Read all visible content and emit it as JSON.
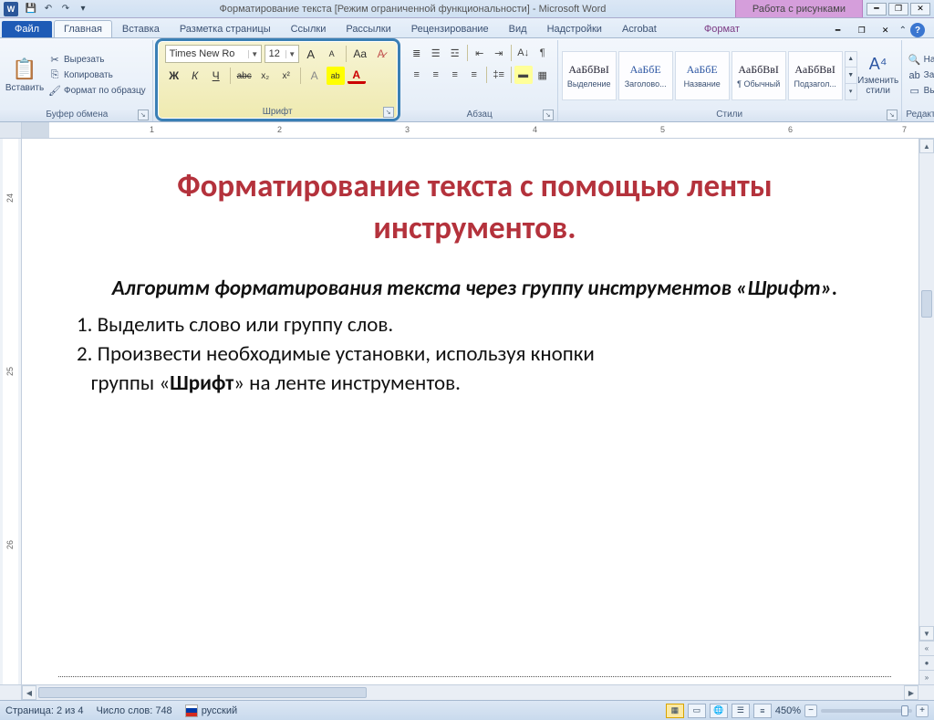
{
  "title": "Форматирование текста [Режим ограниченной функциональности] - Microsoft Word",
  "context_tab_title": "Работа с рисунками",
  "qat": {
    "save": "💾",
    "undo": "↶",
    "redo": "↷",
    "more": "▾"
  },
  "tabs": {
    "file": "Файл",
    "items": [
      "Главная",
      "Вставка",
      "Разметка страницы",
      "Ссылки",
      "Рассылки",
      "Рецензирование",
      "Вид",
      "Надстройки",
      "Acrobat"
    ],
    "ctx": "Формат",
    "active_index": 0
  },
  "clipboard": {
    "label": "Буфер обмена",
    "paste": "Вставить",
    "cut": "Вырезать",
    "copy": "Копировать",
    "format_painter": "Формат по образцу"
  },
  "font": {
    "label": "Шрифт",
    "name": "Times New Ro",
    "size": "12",
    "buttons": {
      "grow": "A▲",
      "shrink": "A▼",
      "case": "Aa▾",
      "clear": "⌫",
      "bold": "Ж",
      "italic": "К",
      "underline": "Ч",
      "strike": "abc",
      "sub": "x₂",
      "sup": "x²",
      "effects": "A",
      "highlight": "ab",
      "color": "A"
    }
  },
  "paragraph": {
    "label": "Абзац"
  },
  "styles": {
    "label": "Стили",
    "items": [
      {
        "preview": "АаБбВвІ",
        "name": "Выделение",
        "cls": ""
      },
      {
        "preview": "АаБбЕ",
        "name": "Заголово...",
        "cls": "blue"
      },
      {
        "preview": "АаБбЕ",
        "name": "Название",
        "cls": "blue"
      },
      {
        "preview": "АаБбВвІ",
        "name": "¶ Обычный",
        "cls": ""
      },
      {
        "preview": "АаБбВвІ",
        "name": "Подзагол...",
        "cls": ""
      }
    ],
    "change": "Изменить стили"
  },
  "editing": {
    "label": "Редактирование",
    "find": "Найти",
    "replace": "Заменить",
    "select": "Выделить"
  },
  "ruler_h_nums": [
    "1",
    "2",
    "3",
    "4",
    "5",
    "6",
    "7"
  ],
  "ruler_v_nums": [
    "24",
    "25",
    "26"
  ],
  "doc": {
    "title": "Форматирование текста с помощью ленты инструментов.",
    "sub": "Алгоритм форматирования текста через группу инструментов «Шрифт».",
    "line1": "1. Выделить слово или группу слов.",
    "line2_a": "2. Произвести необходимые установки, используя кнопки",
    "line2_b": "группы «",
    "line2_bold": "Шрифт",
    "line2_c": "» на ленте инструментов."
  },
  "status": {
    "page": "Страница: 2 из 4",
    "words": "Число слов: 748",
    "lang": "русский",
    "zoom": "450%"
  }
}
